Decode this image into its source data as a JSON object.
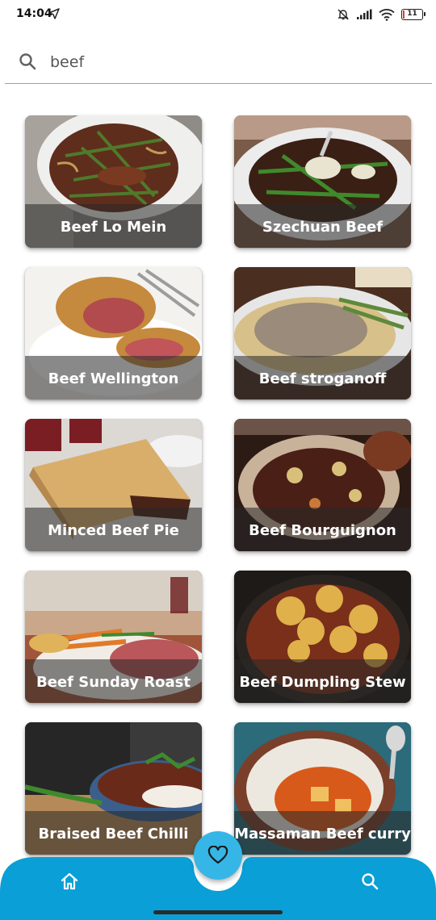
{
  "status_bar": {
    "time": "14:04",
    "battery": "11"
  },
  "search": {
    "query": "beef",
    "icon": "search-icon"
  },
  "recipes": [
    {
      "title": "Beef Lo Mein"
    },
    {
      "title": "Szechuan Beef"
    },
    {
      "title": "Beef Wellington"
    },
    {
      "title": "Beef stroganoff"
    },
    {
      "title": "Minced Beef Pie"
    },
    {
      "title": "Beef Bourguignon"
    },
    {
      "title": "Beef Sunday Roast"
    },
    {
      "title": "Beef Dumpling Stew"
    },
    {
      "title": "Braised Beef Chilli"
    },
    {
      "title": "Massaman Beef curry"
    }
  ],
  "bottom_nav": {
    "home_icon": "home-icon",
    "favorites_icon": "heart-icon",
    "search_icon": "search-icon"
  },
  "colors": {
    "nav_bar": "#0a9fd6",
    "fab": "#35b6e6"
  }
}
